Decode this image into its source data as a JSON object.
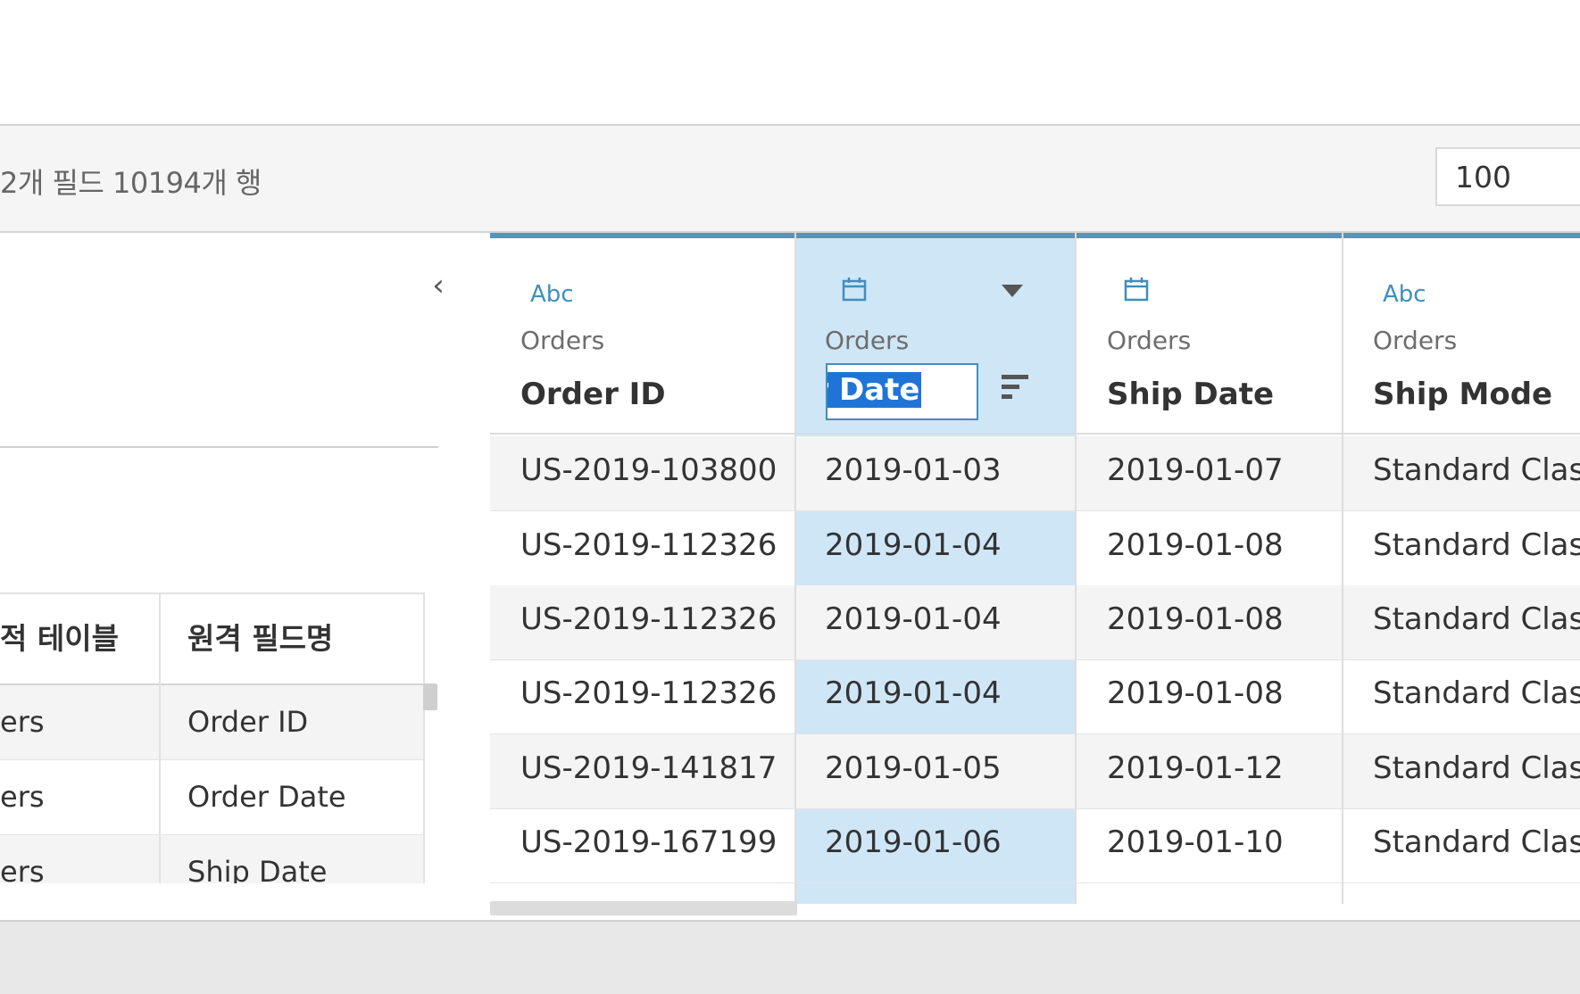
{
  "toolbar": {
    "summary": "2개 필드 10194개 행",
    "row_limit_value": "100"
  },
  "left_panel": {
    "collapse_icon": "chevron-left-icon",
    "metadata_table": {
      "headers": [
        "적 테이블",
        "원격 필드명"
      ],
      "rows": [
        {
          "table": "ers",
          "field": "Order ID"
        },
        {
          "table": "ers",
          "field": "Order Date"
        },
        {
          "table": "ers",
          "field": "Ship Date"
        }
      ]
    }
  },
  "grid": {
    "columns": [
      {
        "type_icon": "Abc",
        "table": "Orders",
        "field": "Order ID"
      },
      {
        "type_icon": "calendar-icon",
        "table": "Orders",
        "field": "Order Date",
        "editing_visible_text": "der Date"
      },
      {
        "type_icon": "calendar-icon",
        "table": "Orders",
        "field": "Ship Date"
      },
      {
        "type_icon": "Abc",
        "table": "Orders",
        "field": "Ship Mode"
      }
    ],
    "rows": [
      [
        "US-2019-103800",
        "2019-01-03",
        "2019-01-07",
        "Standard Class"
      ],
      [
        "US-2019-112326",
        "2019-01-04",
        "2019-01-08",
        "Standard Class"
      ],
      [
        "US-2019-112326",
        "2019-01-04",
        "2019-01-08",
        "Standard Class"
      ],
      [
        "US-2019-112326",
        "2019-01-04",
        "2019-01-08",
        "Standard Class"
      ],
      [
        "US-2019-141817",
        "2019-01-05",
        "2019-01-12",
        "Standard Class"
      ],
      [
        "US-2019-167199",
        "2019-01-06",
        "2019-01-10",
        "Standard Class"
      ]
    ]
  },
  "colors": {
    "header_accent": "#4f96c4",
    "selected_column": "#cfe6f7",
    "text_selection": "#1f74d6"
  }
}
